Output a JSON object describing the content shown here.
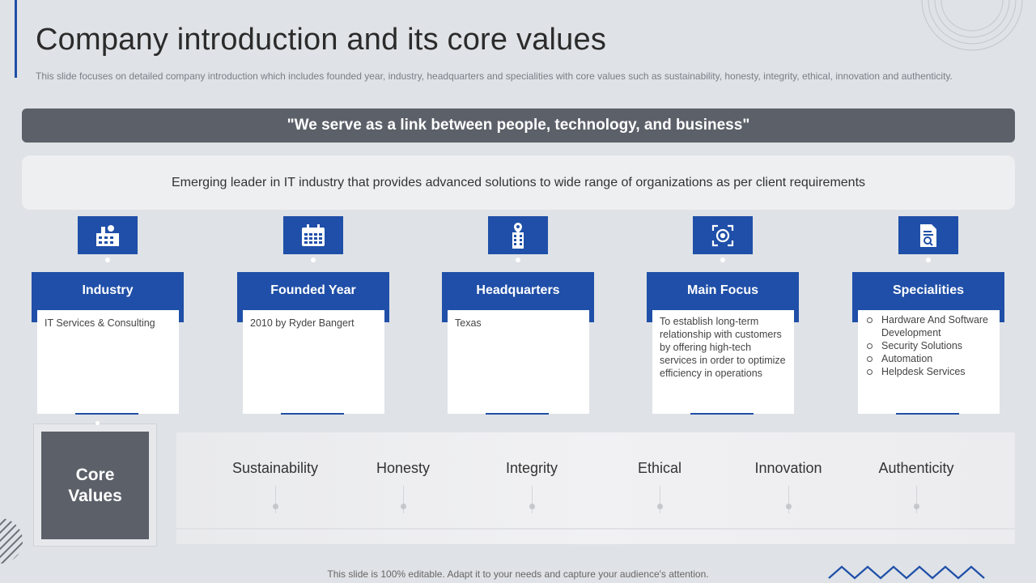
{
  "slide": {
    "title": "Company introduction and its core values",
    "subtitle": "This slide focuses on detailed company introduction which includes founded year, industry, headquarters and specialities with core values such as sustainability, honesty, integrity, ethical, innovation and authenticity.",
    "tagline": "\"We serve as a link between people, technology, and business\"",
    "description": "Emerging leader in IT industry that provides advanced solutions to wide range of organizations as per client requirements",
    "footer": "This slide is 100% editable. Adapt it to your needs and capture your audience's attention."
  },
  "cards": [
    {
      "heading": "Industry",
      "icon": "factory-icon",
      "text": "IT Services & Consulting"
    },
    {
      "heading": "Founded Year",
      "icon": "calendar-icon",
      "text": "2010 by Ryder Bangert"
    },
    {
      "heading": "Headquarters",
      "icon": "building-location-icon",
      "text": "Texas"
    },
    {
      "heading": "Main Focus",
      "icon": "target-icon",
      "text": "To establish long-term relationship with customers by offering high-tech services in order to optimize efficiency in operations"
    },
    {
      "heading": "Specialities",
      "icon": "document-search-icon",
      "items": [
        "Hardware And Software Development",
        "Security Solutions",
        "Automation",
        "Helpdesk Services"
      ]
    }
  ],
  "core_values": {
    "label_line1": "Core",
    "label_line2": "Values",
    "values": [
      "Sustainability",
      "Honesty",
      "Integrity",
      "Ethical",
      "Innovation",
      "Authenticity"
    ]
  },
  "colors": {
    "accent": "#1f4fa8",
    "dark_band": "#5b6069",
    "background": "#dfe2e6"
  }
}
